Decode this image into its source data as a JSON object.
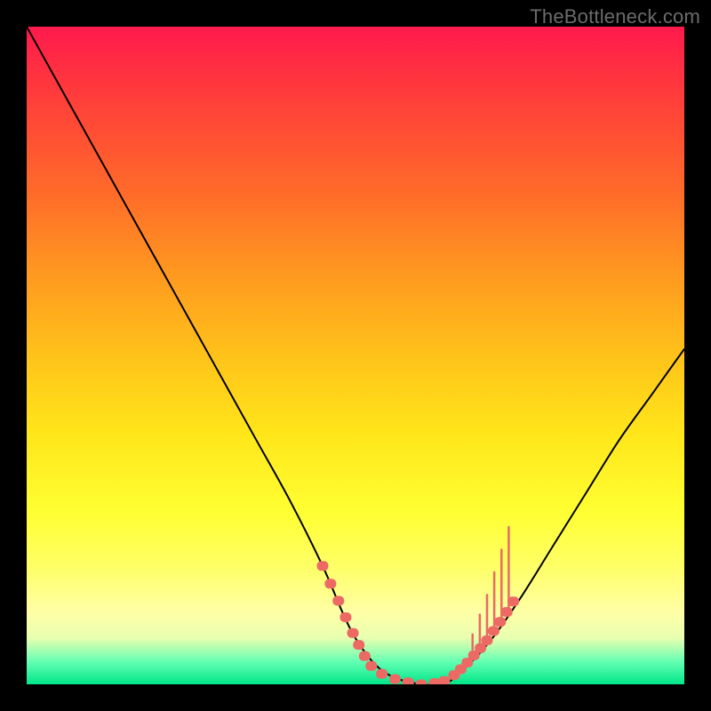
{
  "watermark": "TheBottleneck.com",
  "chart_data": {
    "type": "line",
    "title": "",
    "xlabel": "",
    "ylabel": "",
    "xlim": [
      0,
      100
    ],
    "ylim": [
      0,
      100
    ],
    "series": [
      {
        "name": "curve",
        "x": [
          0,
          5,
          10,
          15,
          20,
          25,
          30,
          35,
          40,
          45,
          48,
          50,
          53,
          56,
          60,
          63,
          65,
          70,
          75,
          80,
          85,
          90,
          95,
          100
        ],
        "y": [
          100,
          91,
          82,
          73,
          64,
          55,
          46,
          37,
          28,
          18,
          11,
          7,
          3,
          1,
          0,
          0,
          1,
          6,
          13,
          21,
          29,
          37,
          44,
          51
        ]
      }
    ],
    "markers": {
      "name": "highlight-dots",
      "color": "#ec6a63",
      "points": [
        {
          "x": 45.0,
          "y": 18.0
        },
        {
          "x": 46.2,
          "y": 15.3
        },
        {
          "x": 47.4,
          "y": 12.7
        },
        {
          "x": 48.5,
          "y": 10.2
        },
        {
          "x": 49.6,
          "y": 7.8
        },
        {
          "x": 50.5,
          "y": 6.0
        },
        {
          "x": 51.4,
          "y": 4.3
        },
        {
          "x": 52.4,
          "y": 2.8
        },
        {
          "x": 54.0,
          "y": 1.6
        },
        {
          "x": 56.0,
          "y": 0.8
        },
        {
          "x": 58.0,
          "y": 0.3
        },
        {
          "x": 60.0,
          "y": 0.0
        },
        {
          "x": 62.0,
          "y": 0.2
        },
        {
          "x": 63.5,
          "y": 0.5
        },
        {
          "x": 65.0,
          "y": 1.4
        },
        {
          "x": 66.0,
          "y": 2.3
        },
        {
          "x": 67.0,
          "y": 3.3
        },
        {
          "x": 68.0,
          "y": 4.4
        },
        {
          "x": 69.0,
          "y": 5.5
        },
        {
          "x": 70.0,
          "y": 6.7
        },
        {
          "x": 71.0,
          "y": 8.1
        },
        {
          "x": 72.0,
          "y": 9.5
        },
        {
          "x": 73.0,
          "y": 11.0
        },
        {
          "x": 74.0,
          "y": 12.6
        }
      ]
    },
    "ticks": {
      "short": [
        {
          "x": 67.8,
          "h": 1.0
        },
        {
          "x": 68.9,
          "h": 1.5
        },
        {
          "x": 70.0,
          "h": 2.0
        },
        {
          "x": 71.1,
          "h": 2.5
        },
        {
          "x": 72.2,
          "h": 3.0
        },
        {
          "x": 73.3,
          "h": 3.5
        }
      ]
    }
  }
}
